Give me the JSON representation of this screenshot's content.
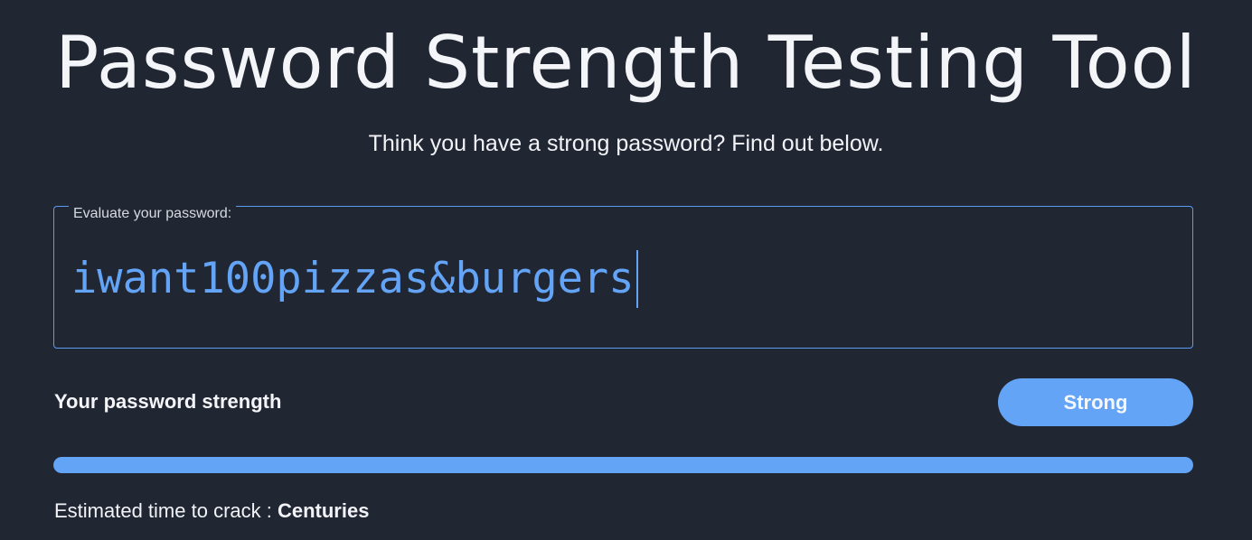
{
  "header": {
    "title": "Password Strength Testing Tool",
    "subtitle": "Think you have a strong password? Find out below."
  },
  "password_field": {
    "legend": "Evaluate your password:",
    "value": "iwant100pizzas&burgers"
  },
  "strength": {
    "label": "Your password strength",
    "rating": "Strong",
    "progress_fraction": 1.0
  },
  "crack_time": {
    "label": "Estimated time to crack : ",
    "value": "Centuries"
  },
  "colors": {
    "background": "#212633",
    "accent": "#63a4f7",
    "text": "#f1f3f7"
  }
}
